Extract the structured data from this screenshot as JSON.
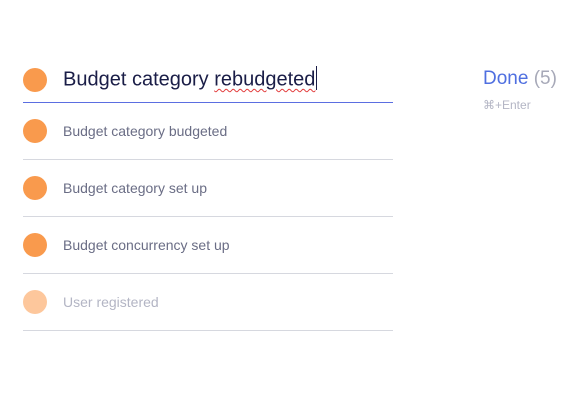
{
  "editor": {
    "prefix": "Budget category ",
    "misspelled_word": "rebudgeted"
  },
  "items": [
    {
      "label": "Budget category budgeted",
      "faded": false
    },
    {
      "label": "Budget category set up",
      "faded": false
    },
    {
      "label": "Budget concurrency set up",
      "faded": false
    },
    {
      "label": "User registered",
      "faded": true
    }
  ],
  "done": {
    "label": "Done",
    "count": "(5)",
    "shortcut": "⌘+Enter"
  },
  "colors": {
    "dot": "#f99a4d",
    "dot_faded": "#fdc79c",
    "accent": "#4f6fe0"
  }
}
